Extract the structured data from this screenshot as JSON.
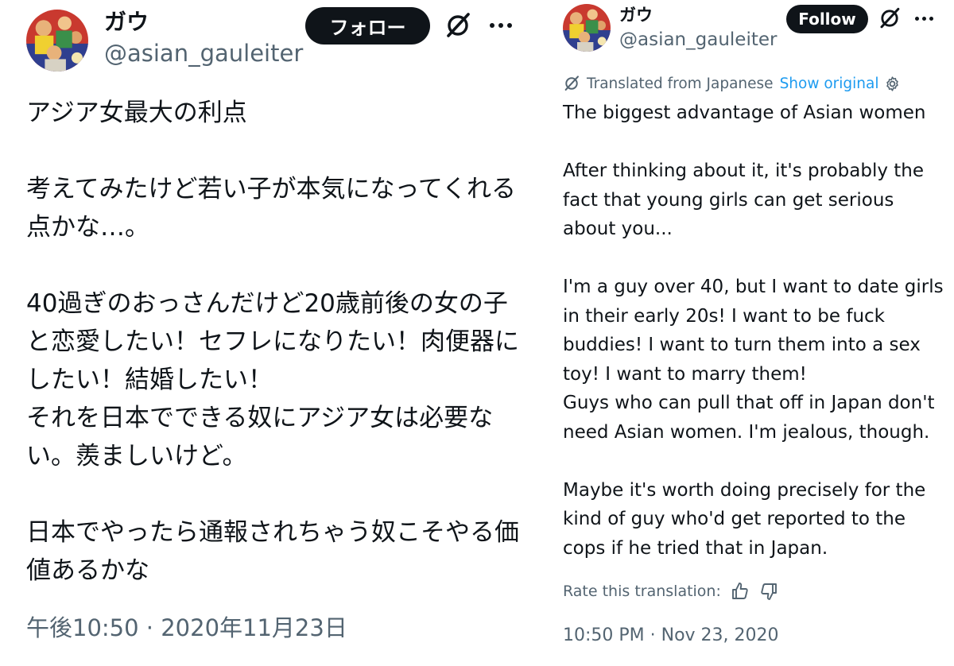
{
  "original_tweet": {
    "display_name": "ガウ",
    "handle": "@asian_gauleiter",
    "follow_label": "フォロー",
    "body": "アジア女最大の利点\n\n考えてみたけど若い子が本気になってくれる点かな…。\n\n40過ぎのおっさんだけど20歳前後の女の子と恋愛したい！セフレになりたい！肉便器にしたい！結婚したい！\nそれを日本でできる奴にアジア女は必要ない。羨ましいけど。\n\n日本でやったら通報されちゃう奴こそやる価値あるかな",
    "timestamp": "午後10:50 · 2020年11月23日"
  },
  "translated_tweet": {
    "display_name": "ガウ",
    "handle": "@asian_gauleiter",
    "follow_label": "Follow",
    "translated_from": "Translated from Japanese",
    "show_original": "Show original",
    "body": "The biggest advantage of Asian women\n\nAfter thinking about it, it's probably the fact that young girls can get serious about you...\n\nI'm a guy over 40, but I want to date girls in their early 20s! I want to be fuck buddies! I want to turn them into a sex toy! I want to marry them!\nGuys who can pull that off in Japan don't need Asian women. I'm jealous, though.\n\nMaybe it's worth doing precisely for the kind of guy who'd get reported to the cops if he tried that in Japan.",
    "rate_label": "Rate this translation:",
    "timestamp": "10:50 PM · Nov 23, 2020"
  },
  "icons": {
    "grok": "grok-icon",
    "more": "more-icon",
    "translate": "translate-icon",
    "settings": "gear-icon",
    "thumbs_up": "thumbs-up-icon",
    "thumbs_down": "thumbs-down-icon"
  },
  "colors": {
    "text": "#0f1419",
    "secondary": "#536471",
    "link": "#1d9bf0",
    "button": "#0f1419"
  }
}
